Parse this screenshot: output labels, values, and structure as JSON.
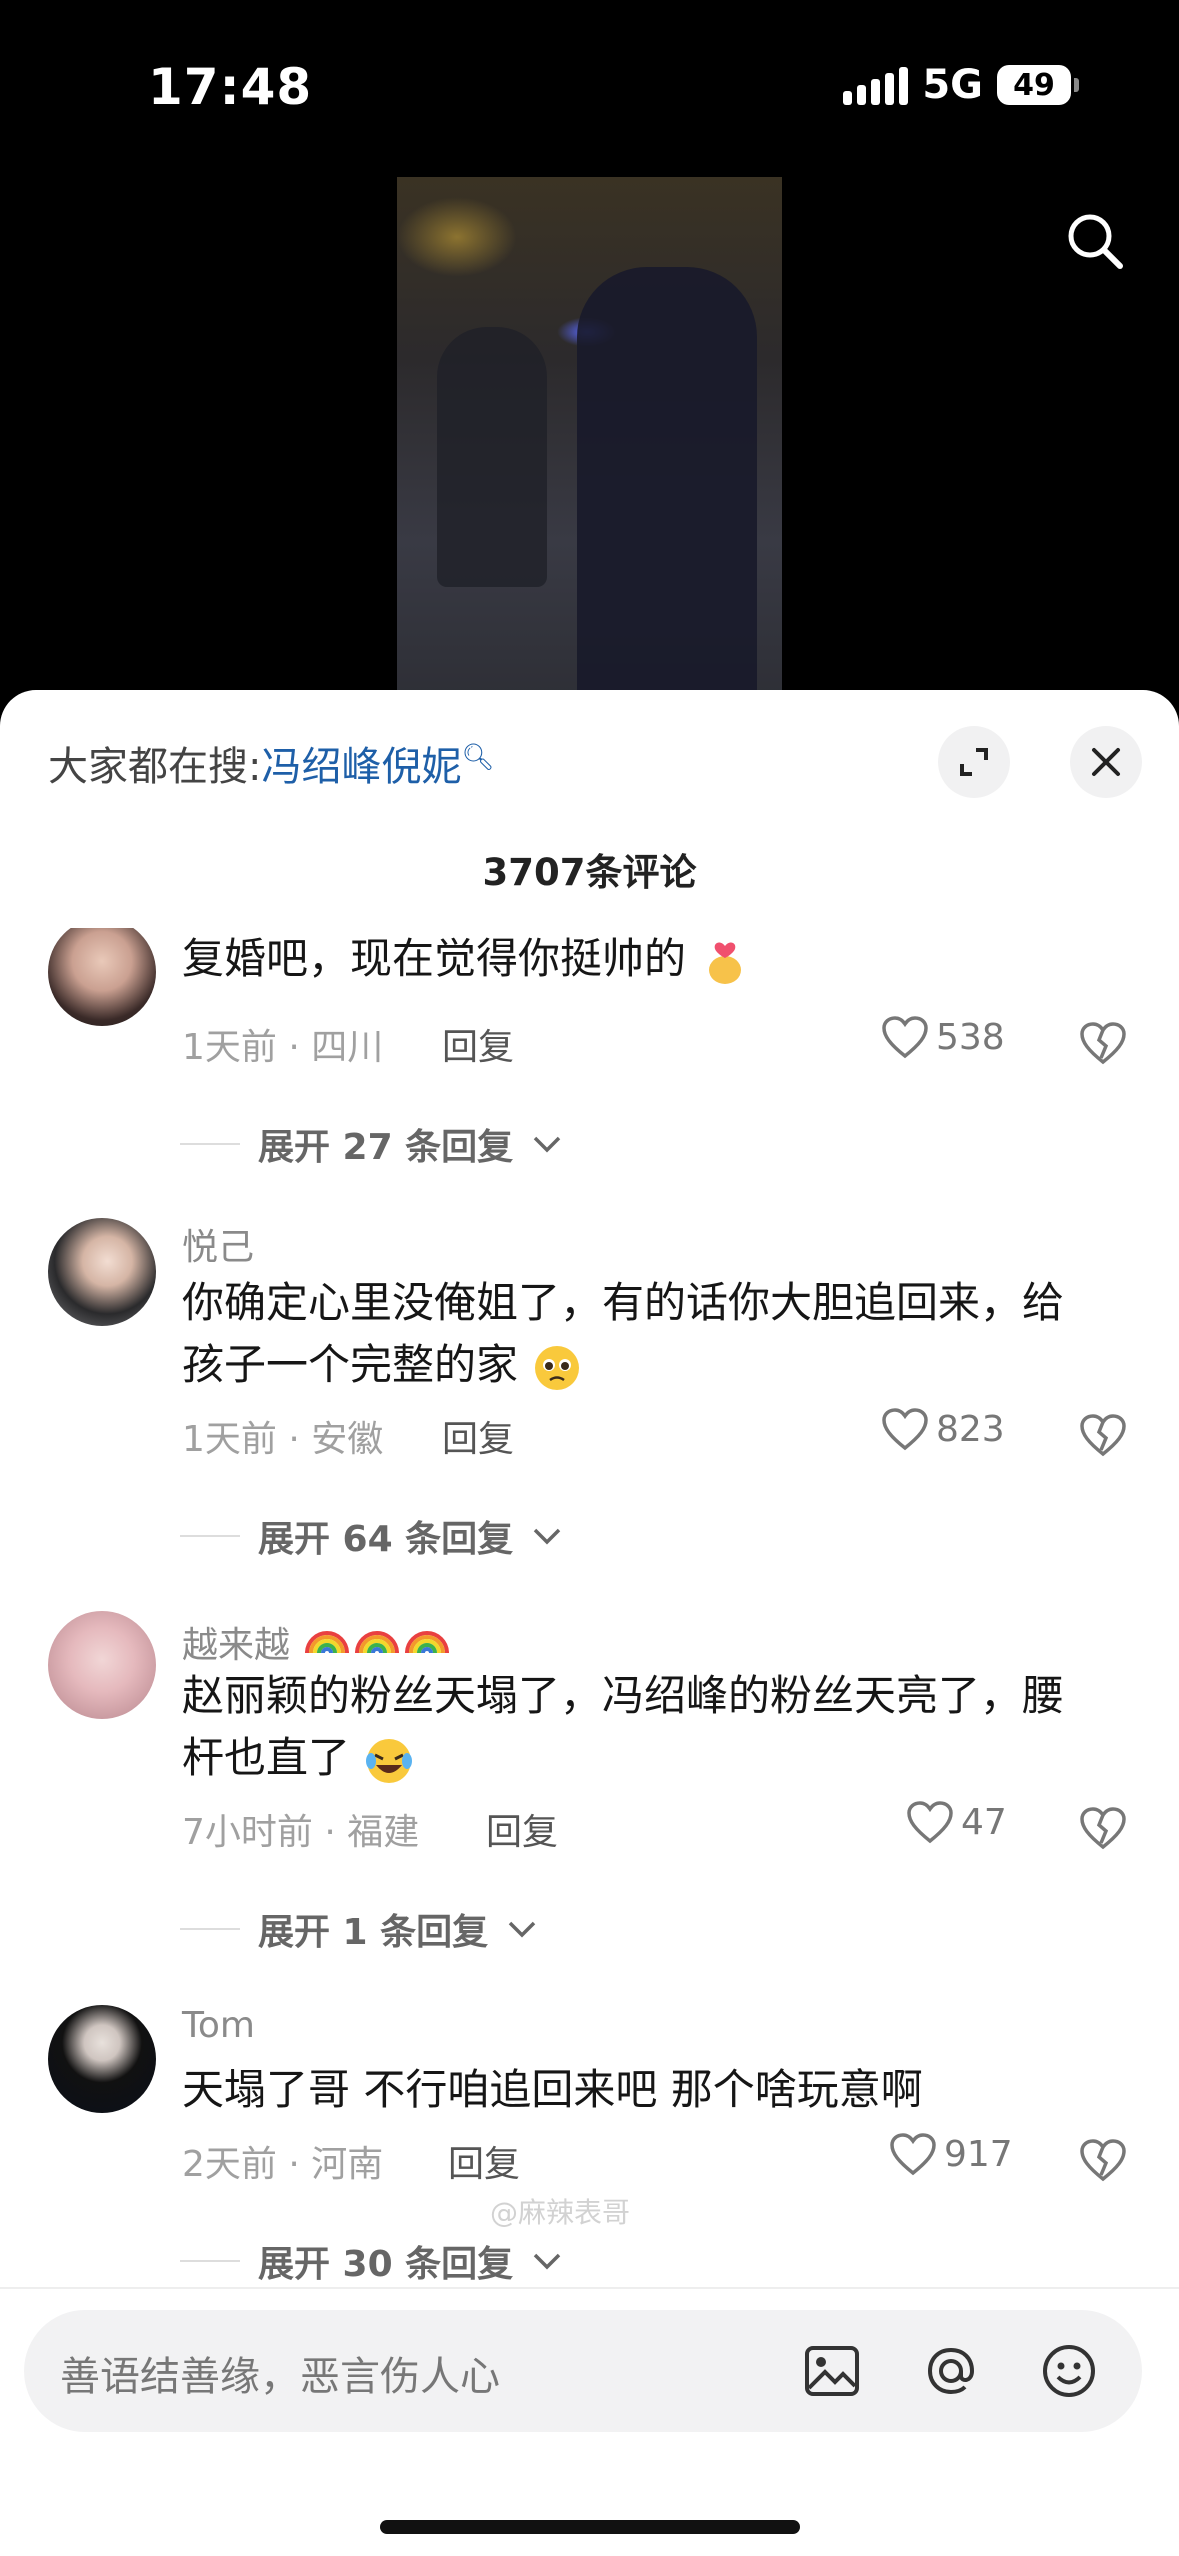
{
  "status": {
    "time": "17:48",
    "network": "5G",
    "battery": "49"
  },
  "panel": {
    "hot_prefix": "大家都在搜:",
    "hot_keyword": "冯绍峰倪妮",
    "comment_count": "3707条评论"
  },
  "watermark": "@麻辣表哥",
  "comments": [
    {
      "user": "",
      "text": "复婚吧，现在觉得你挺帅的",
      "meta": "1天前 · 四川",
      "reply_label": "回复",
      "likes": "538",
      "expand_label": "展开 27 条回复"
    },
    {
      "user": "悦己",
      "text": "你确定心里没俺姐了，有的话你大胆追回来，给孩子一个完整的家",
      "meta": "1天前 · 安徽",
      "reply_label": "回复",
      "likes": "823",
      "expand_label": "展开 64 条回复"
    },
    {
      "user": "越来越",
      "text": "赵丽颖的粉丝天塌了，冯绍峰的粉丝天亮了，腰杆也直了",
      "meta": "7小时前 · 福建",
      "reply_label": "回复",
      "likes": "47",
      "expand_label": "展开 1 条回复"
    },
    {
      "user": "Tom",
      "text": "天塌了哥 不行咱追回来吧 那个啥玩意啊",
      "meta": "2天前 · 河南",
      "reply_label": "回复",
      "likes": "917",
      "expand_label": "展开 30 条回复"
    }
  ],
  "input": {
    "placeholder": "善语结善缘，恶言伤人心"
  },
  "icons": [
    "search-icon",
    "expand-icon",
    "close-icon",
    "heart-icon",
    "broken-heart-icon",
    "chevron-down-icon",
    "image-icon",
    "at-icon",
    "emoji-icon"
  ]
}
